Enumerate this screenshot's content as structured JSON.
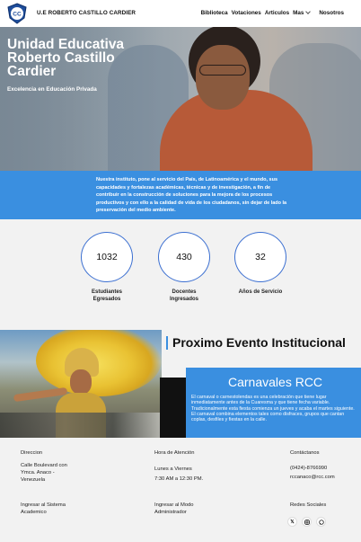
{
  "nav": {
    "brand": "U.E ROBERTO CASTILLO CARDIER",
    "logo_text": "CC",
    "items": [
      "Biblioteca",
      "Votaciones",
      "Articulos",
      "Mas",
      "Nosotros"
    ]
  },
  "hero": {
    "title": "Unidad Educativa Roberto Castillo Cardier",
    "subtitle": "Excelencia en Educación Privada"
  },
  "mission": {
    "text": "Nuestra instituto, pone al servicio del País, de Latinoamérica y el mundo, sus capacidades y fortalezas académicas, técnicas y de investigación, a fin de contribuir en la construcción de soluciones para la mejora de los procesos productivos y con ello a la calidad de vida de los ciudadanos, sin dejar de lado la preservación del medio ambiente."
  },
  "stats": [
    {
      "value": "1032",
      "label": "Estudiantes Egresados"
    },
    {
      "value": "430",
      "label": "Docentes Ingresados"
    },
    {
      "value": "32",
      "label": "Años de Servicio"
    }
  ],
  "event": {
    "section_title": "Proximo Evento Institucional",
    "name": "Carnavales RCC",
    "description": "El carnaval o carnestolendas es una celebración que tiene lugar inmediatamente antes de la Cuaresma y que tiene fecha variable. Tradicionalmente esta fiesta comienza un jueves y acaba el martes siguiente. El carnaval combina elementos tales como disfraces, grupos que cantan coplas, desfiles y fiestas en la calle."
  },
  "footer": {
    "direccion_title": "Direccion",
    "direccion_text": "Calle Boulevard con Ymca. Anaco - Venezuela",
    "horario_title": "Hora de Atención",
    "horario_days": "Lunes a Viernes",
    "horario_hours": "7:30 AM a 12:30 PM.",
    "contact_title": "Contáctanos",
    "phone": "(0424)-8766990",
    "email": "rccanaco@rcc.com",
    "login_system": "Ingresar al Sistema Academico",
    "login_admin": "Ingresar al Modo Administrador",
    "social_title": "Redes Sociales",
    "social_icons": [
      "x-icon",
      "instagram-icon",
      "whatsapp-icon"
    ]
  }
}
